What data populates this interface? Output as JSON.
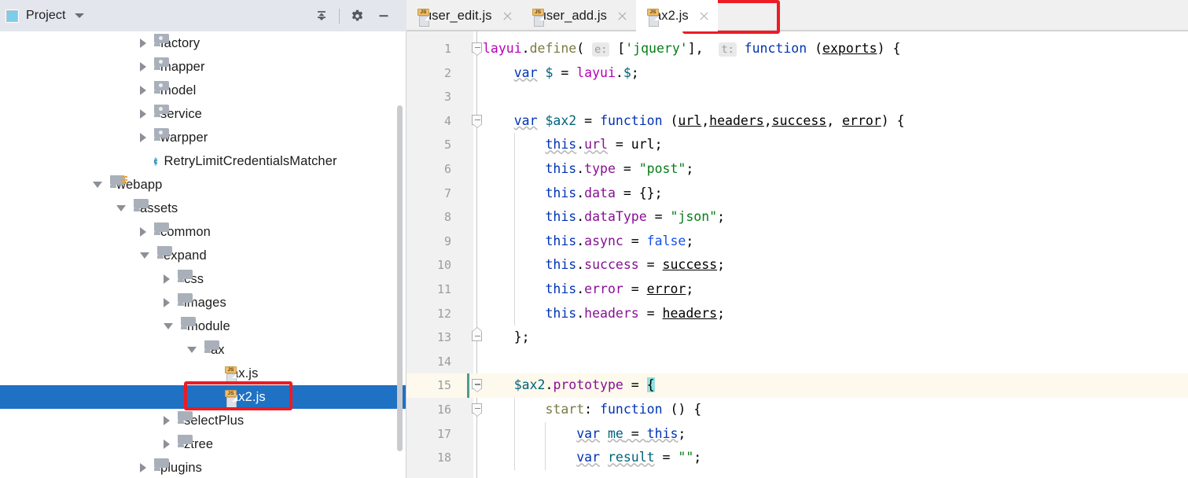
{
  "project_panel": {
    "title": "Project",
    "icons": {
      "project_icon": "project-square-icon",
      "dropdown": "chevron-down-icon",
      "collapse_all": "collapse-all-icon",
      "settings": "gear-icon",
      "hide": "minimize-icon"
    },
    "tree": [
      {
        "label": "factory",
        "indent": 3,
        "state": "collapsed",
        "icon": "folder-source-icon"
      },
      {
        "label": "mapper",
        "indent": 3,
        "state": "collapsed",
        "icon": "folder-source-icon"
      },
      {
        "label": "model",
        "indent": 3,
        "state": "collapsed",
        "icon": "folder-source-icon"
      },
      {
        "label": "service",
        "indent": 3,
        "state": "collapsed",
        "icon": "folder-source-icon"
      },
      {
        "label": "warpper",
        "indent": 3,
        "state": "collapsed",
        "icon": "folder-source-icon"
      },
      {
        "label": "RetryLimitCredentialsMatcher",
        "indent": 3,
        "state": "leaf",
        "icon": "java-class-icon"
      },
      {
        "label": "webapp",
        "indent": 1,
        "state": "expanded",
        "icon": "folder-webapp-icon"
      },
      {
        "label": "assets",
        "indent": 2,
        "state": "expanded",
        "icon": "folder-icon"
      },
      {
        "label": "common",
        "indent": 3,
        "state": "collapsed",
        "icon": "folder-icon"
      },
      {
        "label": "expand",
        "indent": 3,
        "state": "expanded",
        "icon": "folder-icon"
      },
      {
        "label": "css",
        "indent": 4,
        "state": "collapsed",
        "icon": "folder-icon"
      },
      {
        "label": "images",
        "indent": 4,
        "state": "collapsed",
        "icon": "folder-icon"
      },
      {
        "label": "module",
        "indent": 4,
        "state": "expanded",
        "icon": "folder-icon"
      },
      {
        "label": "ax",
        "indent": 5,
        "state": "expanded",
        "icon": "folder-icon"
      },
      {
        "label": "ax.js",
        "indent": 6,
        "state": "leaf",
        "icon": "js-file-icon"
      },
      {
        "label": "ax2.js",
        "indent": 6,
        "state": "leaf",
        "icon": "js-file-icon",
        "selected": true,
        "annotated": true
      },
      {
        "label": "selectPlus",
        "indent": 4,
        "state": "collapsed",
        "icon": "folder-icon"
      },
      {
        "label": "ztree",
        "indent": 4,
        "state": "collapsed",
        "icon": "folder-icon"
      },
      {
        "label": "plugins",
        "indent": 3,
        "state": "collapsed",
        "icon": "folder-icon"
      }
    ]
  },
  "editor": {
    "tabs": [
      {
        "label": "user_edit.js",
        "icon": "js-file-icon",
        "active": false,
        "close": "close-icon"
      },
      {
        "label": "user_add.js",
        "icon": "js-file-icon",
        "active": false,
        "close": "close-icon"
      },
      {
        "label": "ax2.js",
        "icon": "js-file-icon",
        "active": true,
        "close": "close-icon",
        "annotated": true
      }
    ],
    "current_line": 15,
    "line_numbers": [
      1,
      2,
      3,
      4,
      5,
      6,
      7,
      8,
      9,
      10,
      11,
      12,
      13,
      14,
      15,
      16,
      17,
      18
    ],
    "code_lines": [
      {
        "n": 1,
        "text": "layui.define( e: ['jquery'],  t: function (exports) {"
      },
      {
        "n": 2,
        "text": "    var $ = layui.$;"
      },
      {
        "n": 3,
        "text": ""
      },
      {
        "n": 4,
        "text": "    var $ax2 = function (url,headers,success, error) {"
      },
      {
        "n": 5,
        "text": "        this.url = url;"
      },
      {
        "n": 6,
        "text": "        this.type = \"post\";"
      },
      {
        "n": 7,
        "text": "        this.data = {};"
      },
      {
        "n": 8,
        "text": "        this.dataType = \"json\";"
      },
      {
        "n": 9,
        "text": "        this.async = false;"
      },
      {
        "n": 10,
        "text": "        this.success = success;"
      },
      {
        "n": 11,
        "text": "        this.error = error;"
      },
      {
        "n": 12,
        "text": "        this.headers = headers;"
      },
      {
        "n": 13,
        "text": "    };"
      },
      {
        "n": 14,
        "text": ""
      },
      {
        "n": 15,
        "text": "    $ax2.prototype = {"
      },
      {
        "n": 16,
        "text": "        start: function () {"
      },
      {
        "n": 17,
        "text": "            var me = this;"
      },
      {
        "n": 18,
        "text": "            var result = \"\";"
      }
    ],
    "inlay_hints": [
      "e:",
      "t:"
    ],
    "language": "JavaScript"
  },
  "colors": {
    "selection_blue": "#1f71c4",
    "annotation_red": "#ec1c24",
    "panel_header": "#e3e6ed",
    "tab_bar": "#f0f0f0",
    "gutter": "#f1f1f1",
    "current_line": "#fdf9ec",
    "keyword": "#0033b3",
    "string": "#067d17",
    "property": "#871094",
    "local_var": "#00627a",
    "function_name": "#7a7a43",
    "brace_match": "#93e0e0"
  }
}
